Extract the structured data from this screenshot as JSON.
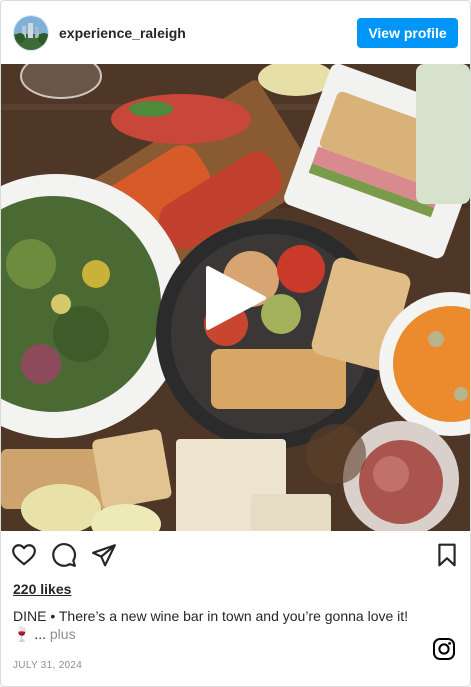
{
  "post": {
    "username": "experience_raleigh",
    "view_profile_label": "View profile",
    "likes": "220 likes",
    "caption_text": "DINE • There’s a new wine bar in town and you’re gonna love it! 🍷",
    "caption_ellipsis": " ... ",
    "more_label": "plus",
    "date": "JULY 31, 2024"
  },
  "icons": {
    "like": "heart-icon",
    "comment": "comment-icon",
    "share": "share-icon",
    "save": "bookmark-icon",
    "play": "play-icon",
    "brand": "instagram-icon"
  },
  "colors": {
    "accent": "#0095f6",
    "text": "#262626",
    "muted": "#8e8e8e",
    "border": "#dbdbdb"
  }
}
